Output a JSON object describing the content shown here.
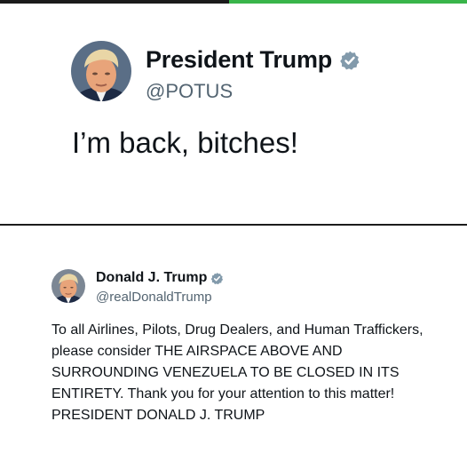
{
  "post_top": {
    "display_name": "President Trump",
    "handle": "@POTUS",
    "text": "I’m back, bitches!",
    "verified_icon": "verified-badge-icon",
    "avatar": "profile-photo"
  },
  "post_bottom": {
    "display_name": "Donald J. Trump",
    "handle": "@realDonaldTrump",
    "text": "To all Airlines, Pilots, Drug Dealers, and Human Traffickers, please consider THE AIRSPACE ABOVE AND SURROUNDING VENEZUELA TO BE CLOSED IN ITS ENTIRETY. Thank you for your attention to this matter! PRESIDENT DONALD J. TRUMP",
    "verified_icon": "verified-badge-icon",
    "avatar": "profile-photo"
  },
  "colors": {
    "text": "#0f1419",
    "handle": "#536471",
    "badge": "#829aab",
    "top_accent": "#39b54a"
  }
}
